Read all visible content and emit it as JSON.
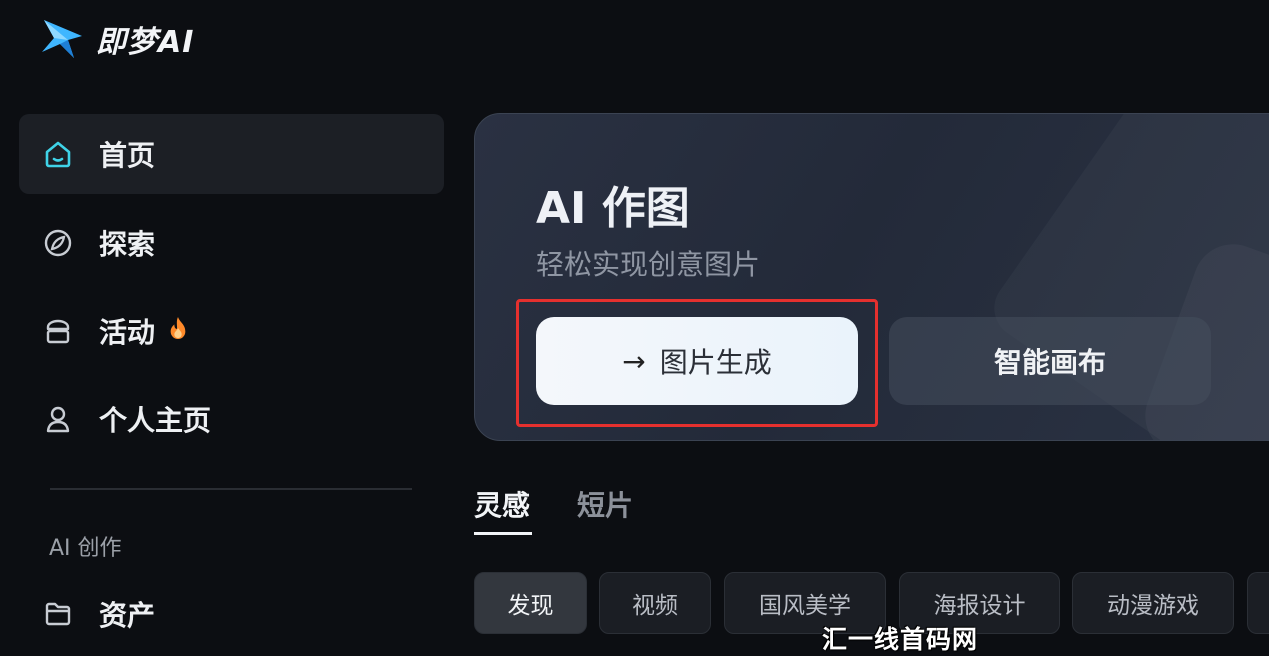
{
  "brand": {
    "name": "即梦AI",
    "accent": "#3fb6ff"
  },
  "sidebar": {
    "items": [
      {
        "label": "首页",
        "icon": "home-icon",
        "active": true
      },
      {
        "label": "探索",
        "icon": "explore-icon"
      },
      {
        "label": "活动",
        "icon": "activity-icon",
        "badge_icon": "fire-icon"
      },
      {
        "label": "个人主页",
        "icon": "user-icon"
      }
    ],
    "section_label": "AI 创作",
    "section_items": [
      {
        "label": "资产",
        "icon": "folder-icon"
      }
    ]
  },
  "hero": {
    "title": "AI 作图",
    "subtitle": "轻松实现创意图片",
    "primary_button": "图片生成",
    "secondary_button": "智能画布",
    "highlight_color": "#e5302e"
  },
  "tabs": [
    {
      "label": "灵感",
      "active": true
    },
    {
      "label": "短片"
    }
  ],
  "chips": [
    {
      "label": "发现",
      "active": true
    },
    {
      "label": "视频"
    },
    {
      "label": "国风美学"
    },
    {
      "label": "海报设计"
    },
    {
      "label": "动漫游戏"
    }
  ],
  "watermark": "汇一线首码网 www.huiyixian.com"
}
